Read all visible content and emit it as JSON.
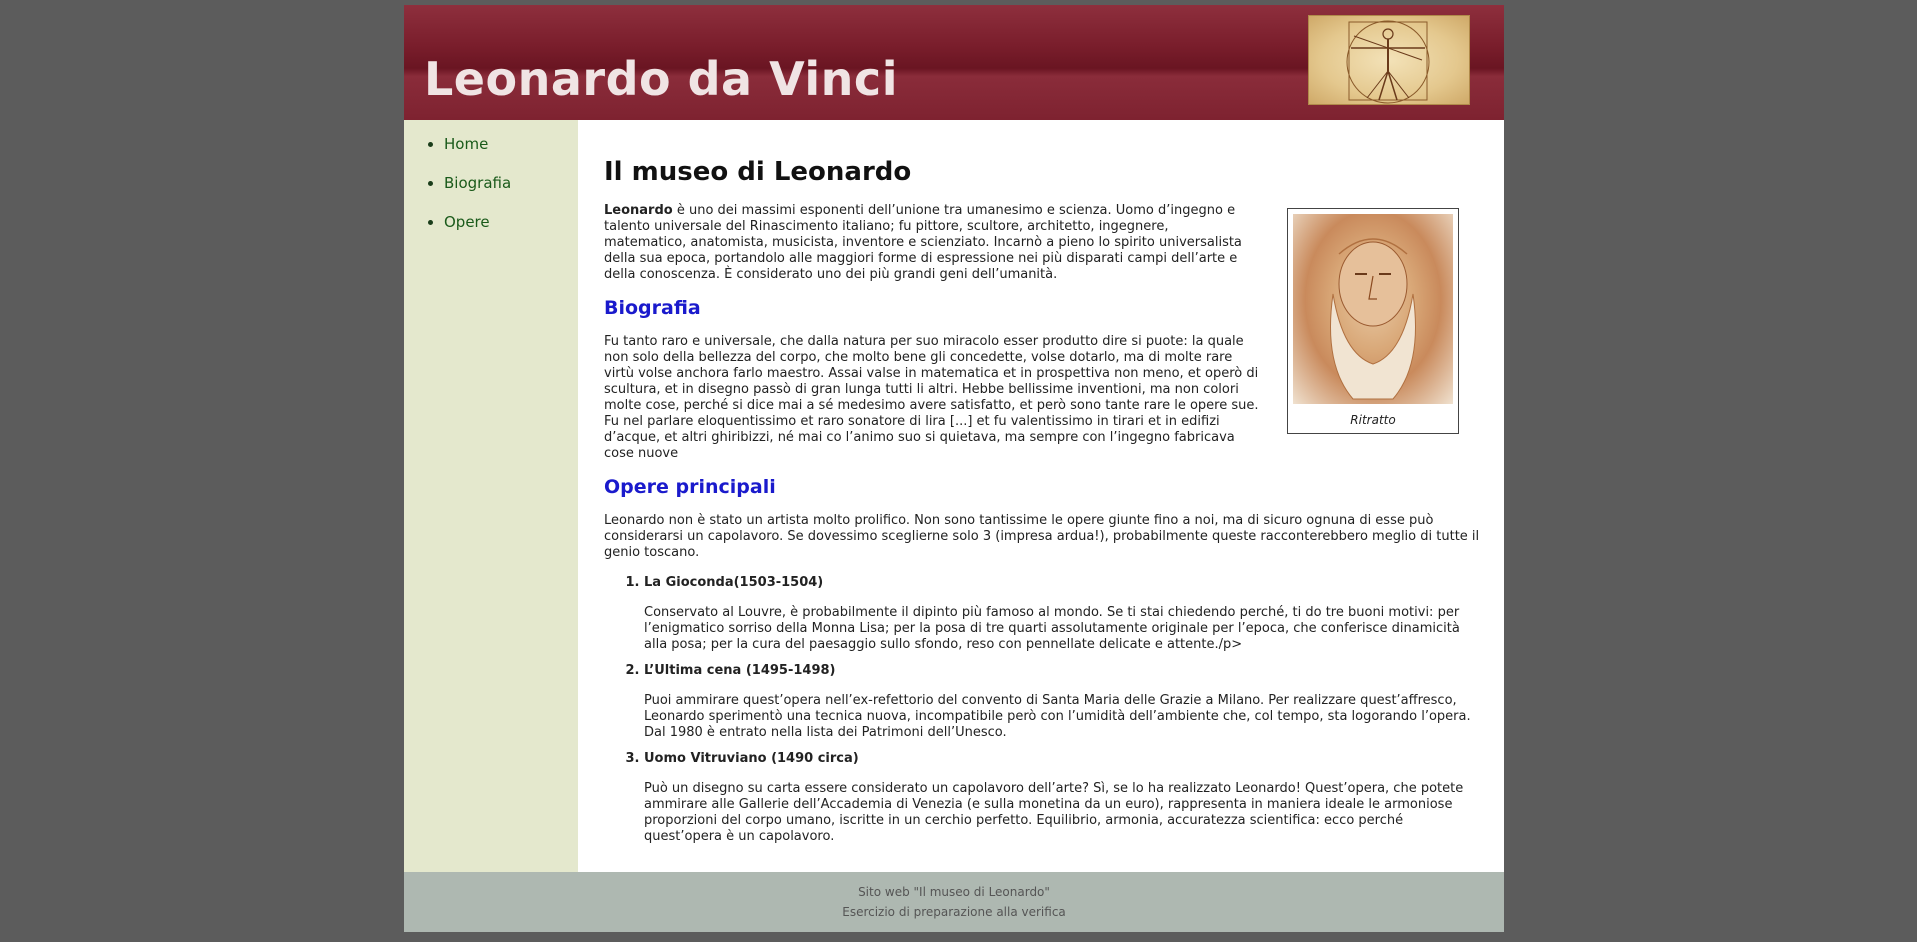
{
  "header": {
    "title": "Leonardo da Vinci"
  },
  "nav": {
    "items": [
      "Home",
      "Biografia",
      "Opere"
    ]
  },
  "main": {
    "title": "Il museo di Leonardo",
    "intro_bold": "Leonardo",
    "intro_text": " è uno dei massimi esponenti dell’unione tra umanesimo e scienza. Uomo d’ingegno e talento universale del Rinascimento italiano; fu pittore, scultore, architetto, ingegnere, matematico, anatomista, musicista, inventore e scienziato. Incarnò a pieno lo spirito universalista della sua epoca, portandolo alle maggiori forme di espressione nei più disparati campi dell’arte e della conoscenza. È considerato uno dei più grandi geni dell’umanità.",
    "portrait_caption": "Ritratto",
    "bio_heading": "Biografia",
    "bio_text": "Fu tanto raro e universale, che dalla natura per suo miracolo esser produtto dire si puote: la quale non solo della bellezza del corpo, che molto bene gli concedette, volse dotarlo, ma di molte rare virtù volse anchora farlo maestro. Assai valse in matematica et in prospettiva non meno, et operò di scultura, et in disegno passò di gran lunga tutti li altri. Hebbe bellissime inventioni, ma non colori molte cose, perché si dice mai a sé medesimo avere satisfatto, et però sono tante rare le opere sue. Fu nel parlare eloquentissimo et raro sonatore di lira [...] et fu valentissimo in tirari et in edifizi d’acque, et altri ghiribizzi, né mai co l’animo suo si quietava, ma sempre con l’ingegno fabricava cose nuove",
    "works_heading": "Opere principali",
    "works_intro": "Leonardo non è stato un artista molto prolifico. Non sono tantissime le opere giunte fino a noi, ma di sicuro ognuna di esse può considerarsi un capolavoro. Se dovessimo sceglierne solo 3 (impresa ardua!), probabilmente queste racconterebbero meglio di tutte il genio toscano.",
    "works": [
      {
        "title": "La Gioconda(1503-1504)",
        "text": "Conservato al Louvre, è probabilmente il dipinto più famoso al mondo. Se ti stai chiedendo perché, ti do tre buoni motivi: per l’enigmatico sorriso della Monna Lisa; per la posa di tre quarti assolutamente originale per l’epoca, che conferisce dinamicità alla posa; per la cura del paesaggio sullo sfondo, reso con pennellate delicate e attente./p>"
      },
      {
        "title": "L’Ultima cena (1495-1498)",
        "text": "Puoi ammirare quest’opera nell’ex-refettorio del convento di Santa Maria delle Grazie a Milano. Per realizzare quest’affresco, Leonardo sperimentò una tecnica nuova, incompatibile però con l’umidità dell’ambiente che, col tempo, sta logorando l’opera. Dal 1980 è entrato nella lista dei Patrimoni dell’Unesco."
      },
      {
        "title": "Uomo Vitruviano (1490 circa)",
        "text": "Può un disegno su carta essere considerato un capolavoro dell’arte? Sì, se lo ha realizzato Leonardo! Quest’opera, che potete ammirare alle Gallerie dell’Accademia di Venezia (e sulla monetina da un euro), rappresenta in maniera ideale le armoniose proporzioni del corpo umano, iscritte in un cerchio perfetto. Equilibrio, armonia, accuratezza scientifica: ecco perché quest’opera è un capolavoro."
      }
    ]
  },
  "footer": {
    "line1": "Sito web \"Il museo di Leonardo\"",
    "line2": "Esercizio di preparazione alla verifica"
  }
}
